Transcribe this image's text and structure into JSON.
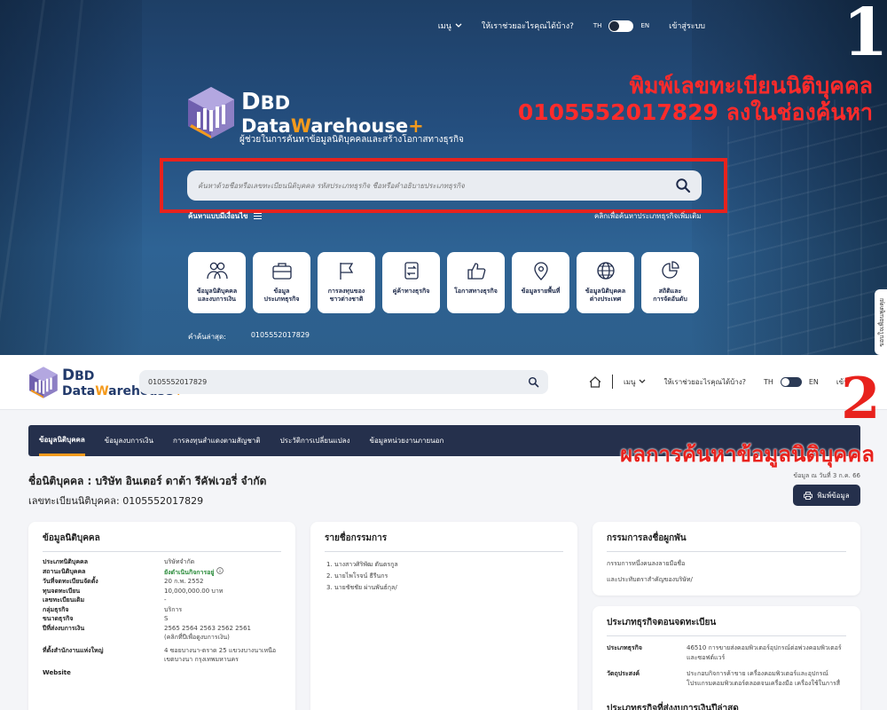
{
  "top": {
    "nav": {
      "menu": "เมนู",
      "help": "ให้เราช่วยอะไรคุณได้บ้าง?",
      "lang_th": "TH",
      "lang_en": "EN",
      "login": "เข้าสู่ระบบ"
    },
    "step_number": "1",
    "annotation_line1": "พิมพ์เลขทะเบียนนิติบุคคล",
    "annotation_line2": "0105552017829 ลงในช่องค้นหา",
    "logo": {
      "d": "D",
      "bd": "BD",
      "data": "Data",
      "w": "W",
      "arehouse": "arehouse",
      "plus": "+"
    },
    "tagline": "ผู้ช่วยในการค้นหาข้อมูลนิติบุคคลและสร้างโอกาสทางธุรกิจ",
    "search_placeholder": "ค้นหาด้วยชื่อหรือเลขทะเบียนนิติบุคคล รหัสประเภทธุรกิจ ชื่อหรือคำอธิบายประเภทธุรกิจ",
    "advanced_search": "ค้นหาแบบมีเงื่อนไข",
    "business_type_link": "คลิกเพื่อค้นหาประเภทธุรกิจเพิ่มเติม",
    "tiles": [
      {
        "label": "ข้อมูลนิติบุคคล\nและงบการเงิน",
        "icon": "people-icon"
      },
      {
        "label": "ข้อมูล\nประเภทธุรกิจ",
        "icon": "briefcase-icon"
      },
      {
        "label": "การลงทุนของ\nชาวต่างชาติ",
        "icon": "flag-icon"
      },
      {
        "label": "คู่ค้าทางธุรกิจ",
        "icon": "exchange-icon"
      },
      {
        "label": "โอกาสทางธุรกิจ",
        "icon": "thumbs-up-icon"
      },
      {
        "label": "ข้อมูลรายพื้นที่",
        "icon": "location-pin-icon"
      },
      {
        "label": "ข้อมูลนิติบุคคล\nต่างประเทศ",
        "icon": "globe-icon"
      },
      {
        "label": "สถิติและ\nการจัดอันดับ",
        "icon": "pie-chart-icon"
      }
    ],
    "recent_label": "คำค้นล่าสุด:",
    "recent_value": "0105552017829",
    "feedback": "ขอบใจเพื่อนพูดคุย"
  },
  "bottom": {
    "search_value": "0105552017829",
    "nav": {
      "menu": "เมนู",
      "help": "ให้เราช่วยอะไรคุณได้บ้าง?",
      "lang_th": "TH",
      "lang_en": "EN",
      "login": "เข้า"
    },
    "step_number": "2",
    "annotation": "ผลการค้นหาข้อมูลนิติบุคคล",
    "tabs": [
      "ข้อมูลนิติบุคคล",
      "ข้อมูลงบการเงิน",
      "การลงทุนสำแดงตามสัญชาติ",
      "ประวัติการเปลี่ยนแปลง",
      "ข้อมูลหน่วยงานภายนอก"
    ],
    "company_name": "ชื่อนิติบุคคล : บริษัท อินเตอร์ ดาต้า รีคัฟเวอรี่ จำกัด",
    "reg_number": "เลขทะเบียนนิติบุคคล: 0105552017829",
    "as_of": "ข้อมูล ณ วันที่ 3 ก.ค. 66",
    "print_label": "พิมพ์ข้อมูล",
    "info_card": {
      "title": "ข้อมูลนิติบุคคล",
      "rows": [
        {
          "k": "ประเภทนิติบุคคล",
          "v": "บริษัทจำกัด"
        },
        {
          "k": "สถานะนิติบุคคล",
          "v": "ยังดำเนินกิจการอยู่"
        },
        {
          "k": "วันที่จดทะเบียนจัดตั้ง",
          "v": "20 ก.พ. 2552"
        },
        {
          "k": "ทุนจดทะเบียน",
          "v": "10,000,000.00 บาท"
        },
        {
          "k": "เลขทะเบียนเดิม",
          "v": "-"
        },
        {
          "k": "กลุ่มธุรกิจ",
          "v": "บริการ"
        },
        {
          "k": "ขนาดธุรกิจ",
          "v": "S"
        },
        {
          "k": "ปีที่ส่งงบการเงิน",
          "v": "2565  2564  2563  2562  2561"
        },
        {
          "k": "",
          "v": "(คลิกที่ปีเพื่อดูงบการเงิน)"
        },
        {
          "k": "ที่ตั้งสำนักงานแห่งใหญ่",
          "v": "4 ซอยบางนา-ตราด 25 แขวงบางนาเหนือ"
        },
        {
          "k": "",
          "v": "เขตบางนา กรุงเทพมหานคร"
        },
        {
          "k": "Website",
          "v": ""
        }
      ]
    },
    "directors_card": {
      "title": "รายชื่อกรรมการ",
      "items": [
        "1. นางสาวศิริพัฒ ตันตรกูล",
        "2. นายไพโรจน์ ธีรีนกร",
        "3. นายชัชชัย ผ่านพันธ์กุล/"
      ]
    },
    "sign_card": {
      "title": "กรรมการลงชื่อผูกพัน",
      "lines": [
        "กรรมการหนึ่งคนลงลายมือชื่อ",
        "และประทับตราสำคัญของบริษัท/"
      ]
    },
    "biz_card": {
      "title": "ประเภทธุรกิจตอนจดทะเบียน",
      "rows": [
        {
          "k": "ประเภทธุรกิจ",
          "v": "46510 การขายส่งคอมพิวเตอร์อุปกรณ์ต่อพ่วงคอมพิวเตอร์และซอฟต์แวร์"
        },
        {
          "k": "วัตถุประสงค์",
          "v": "ประกอบกิจการค้าขาย เครื่องคอมพิวเตอร์และอุปกรณ์ โปรแกรมคอมพิวเตอร์ตลอดจนเครื่องมือ เครื่องใช้ในการสื่"
        }
      ],
      "subtitle": "ประเภทธุรกิจที่ส่งงบการเงินปีล่าสุด"
    }
  },
  "colors": {
    "nav_dark": "#25304c",
    "accent_orange": "#f49a1c",
    "annotation_red": "#e8221d",
    "status_green": "#2a8b3a"
  }
}
